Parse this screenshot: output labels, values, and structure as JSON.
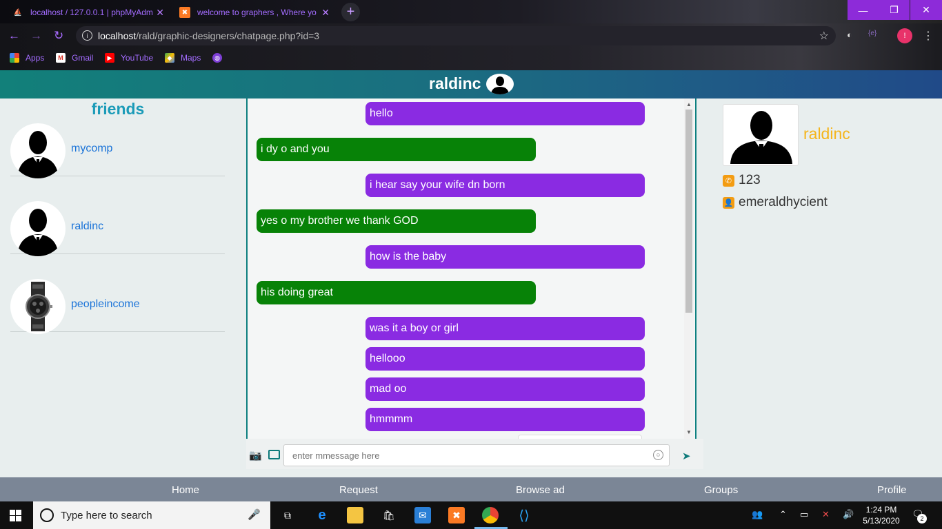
{
  "browser": {
    "tabs": [
      {
        "title": "localhost / 127.0.0.1 | phpMyAdm",
        "icon": "phpmyadmin-icon"
      },
      {
        "title": "welcome to graphers , Where yo",
        "icon": "xampp-icon"
      }
    ],
    "url_host": "localhost",
    "url_path": "/rald/graphic-designers/chatpage.php?id=3",
    "profile_initial": "!",
    "bookmarks": [
      {
        "label": "Apps",
        "icon": "apps-grid-icon"
      },
      {
        "label": "Gmail",
        "icon": "gmail-icon"
      },
      {
        "label": "YouTube",
        "icon": "youtube-icon"
      },
      {
        "label": "Maps",
        "icon": "maps-icon"
      }
    ]
  },
  "header": {
    "title": "raldinc"
  },
  "friends": {
    "title": "friends",
    "items": [
      {
        "name": "mycomp",
        "avatar": "person-silhouette-icon"
      },
      {
        "name": "raldinc",
        "avatar": "person-silhouette-icon"
      },
      {
        "name": "peopleincome",
        "avatar": "wristwatch-image"
      }
    ]
  },
  "chat": {
    "messages": [
      {
        "text": "hello",
        "direction": "out"
      },
      {
        "text": "i dy o and you",
        "direction": "in"
      },
      {
        "text": "i hear say your wife dn born",
        "direction": "out"
      },
      {
        "text": "yes o my brother we thank GOD",
        "direction": "in"
      },
      {
        "text": "how is the baby",
        "direction": "out"
      },
      {
        "text": "his doing great",
        "direction": "in"
      },
      {
        "text": "was it a boy or girl",
        "direction": "out"
      },
      {
        "text": "hellooo",
        "direction": "out"
      },
      {
        "text": "mad oo",
        "direction": "out"
      },
      {
        "text": "hmmmm",
        "direction": "out"
      }
    ],
    "colors": {
      "out": "#8a2be2",
      "in": "#078207"
    },
    "compose_placeholder": "enter mmessage here"
  },
  "profile": {
    "name": "raldinc",
    "phone": "123",
    "username": "emeraldhycient"
  },
  "bottom_nav": [
    "Home",
    "Request",
    "Browse ad",
    "Groups",
    "Profile"
  ],
  "taskbar": {
    "search_placeholder": "Type here to search",
    "time": "1:24 PM",
    "date": "5/13/2020",
    "notifications": "2"
  }
}
